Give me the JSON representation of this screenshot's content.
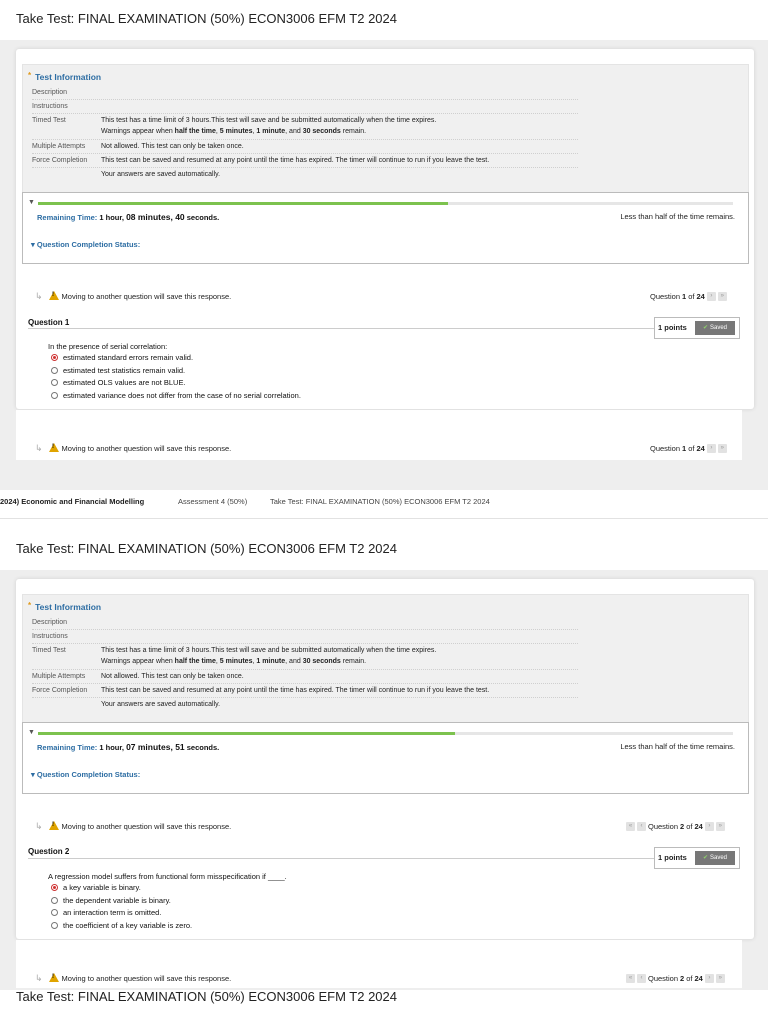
{
  "page_title": "Take Test: FINAL EXAMINATION (50%) ECON3006 EFM T2 2024",
  "breadcrumb": {
    "course": "2024) Economic and Financial Modelling",
    "assessment": "Assessment 4 (50%)",
    "current": "Take Test: FINAL EXAMINATION (50%) ECON3006 EFM T2 2024"
  },
  "test_info": {
    "title": "Test Information",
    "rows": {
      "description_label": "Description",
      "instructions_label": "Instructions",
      "timed_label": "Timed Test",
      "timed_line1": "This test has a time limit of 3 hours.This test will save and be submitted automatically when the time expires.",
      "timed_line2_pre": "Warnings appear when ",
      "timed_half": "half the time",
      "timed_c1": ", ",
      "timed_5": "5 minutes",
      "timed_c2": ", ",
      "timed_1": "1 minute",
      "timed_and": ", and ",
      "timed_30": "30 seconds",
      "timed_end": " remain.",
      "multi_label": "Multiple Attempts",
      "multi_value": "Not allowed. This test can only be taken once.",
      "force_label": "Force Completion",
      "force_value": "This test can be saved and resumed at any point until the time has expired. The timer will continue to run if you leave the test.",
      "autosave": "Your answers are saved automatically."
    }
  },
  "common": {
    "remaining_label": "Remaining Time:",
    "half_remaining": "Less than half of the time remains.",
    "completion_status": "Question Completion Status:",
    "warning": "Moving to another question will save this response.",
    "question_word": "Question",
    "of_word": "of",
    "total": "24",
    "points": "1 points",
    "saved": "Saved"
  },
  "snapshots": [
    {
      "remaining_value_pre": "1 hour, ",
      "remaining_value_big": "08 minutes, 40",
      "remaining_value_post": " seconds.",
      "progress_pct": 59,
      "question_label": "Question 1",
      "question_number": "1",
      "question_text": "In the presence of serial correlation:",
      "options": [
        "estimated standard errors remain valid.",
        "estimated test statistics remain valid.",
        "estimated OLS values are not BLUE.",
        "estimated variance does not differ from the case of no serial correlation."
      ],
      "selected": 0
    },
    {
      "remaining_value_pre": "1 hour, ",
      "remaining_value_big": "07 minutes, 51",
      "remaining_value_post": " seconds.",
      "progress_pct": 60,
      "question_label": "Question 2",
      "question_number": "2",
      "question_text": "A regression model suffers from functional form misspecification if ____.",
      "options": [
        "a key variable is binary.",
        "the dependent variable is binary.",
        "an interaction term is omitted.",
        "the coefficient of a key variable is zero."
      ],
      "selected": 0
    }
  ],
  "icons": {
    "warning": "warning-triangle-icon",
    "arrow": "return-arrow-icon",
    "prev": "chevron-left-icon",
    "first": "double-chevron-left-icon",
    "next": "chevron-right-icon",
    "last": "double-chevron-right-icon",
    "collapse": "triangle-down-icon",
    "info": "star-icon"
  }
}
